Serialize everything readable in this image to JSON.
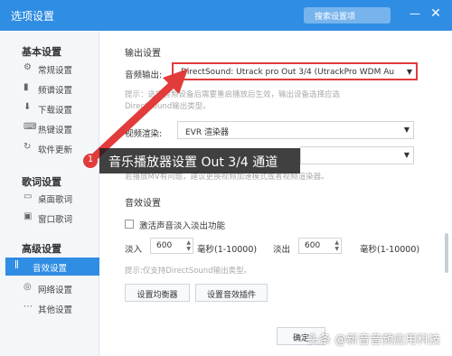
{
  "window": {
    "title": "选项设置",
    "search_placeholder": "搜索设置项"
  },
  "sidebar": {
    "basic_title": "基本设置",
    "basic_items": [
      {
        "label": "常规设置",
        "icon": "gear-icon"
      },
      {
        "label": "频谱设置",
        "icon": "spectrum-icon"
      },
      {
        "label": "下载设置",
        "icon": "download-icon"
      },
      {
        "label": "热键设置",
        "icon": "hotkey-icon"
      },
      {
        "label": "软件更新",
        "icon": "update-icon"
      }
    ],
    "lyrics_title": "歌词设置",
    "lyrics_items": [
      {
        "label": "桌面歌词",
        "icon": "desktop-lyrics-icon"
      },
      {
        "label": "窗口歌词",
        "icon": "window-lyrics-icon"
      }
    ],
    "advanced_title": "高级设置",
    "advanced_items": [
      {
        "label": "音效设置",
        "icon": "equalizer-icon",
        "active": true
      },
      {
        "label": "网络设置",
        "icon": "network-icon"
      },
      {
        "label": "其他设置",
        "icon": "more-icon"
      }
    ]
  },
  "output": {
    "heading": "输出设置",
    "audio_label": "音频输出:",
    "audio_value": "DirectSound: Utrack pro Out 3/4 (UtrackPro WDM Au",
    "hint1_line1": "提示：选择音频设备后需要重启播放后生效，输出设备选择应选",
    "hint1_line2": "DirectSound输出类型。",
    "video_label": "视频渲染:",
    "video_value": "EVR 渲染器",
    "hint2": "若播放MV有问题，建议更换视频加速模式或者视频渲染器。"
  },
  "effects": {
    "heading": "音效设置",
    "fade_label": "激活声音淡入淡出功能",
    "fade_in_label": "淡入",
    "fade_in_value": "600",
    "fade_out_label": "淡出",
    "fade_out_value": "600",
    "ms_unit": "毫秒(1-10000)",
    "hint3": "提示:仅支持DirectSound输出类型。",
    "eq_button": "设置均衡器",
    "plugin_button": "设置音效插件"
  },
  "footer": {
    "ok_button": "确定"
  },
  "annotation": {
    "badge": "1",
    "tooltip": "音乐播放器设置 Out 3/4 通道"
  },
  "watermark": "头条 @新音音频应用科技",
  "colors": {
    "accent": "#2f8de4",
    "highlight": "#e23b3b"
  }
}
